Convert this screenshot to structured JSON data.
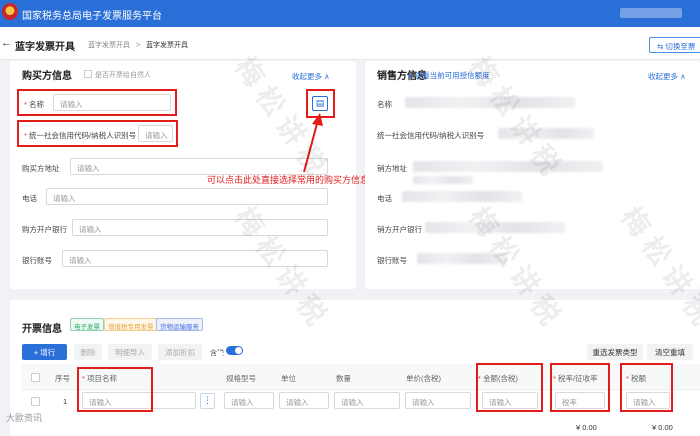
{
  "app": {
    "title": "国家税务总局电子发票服务平台",
    "switch_label": "切换至票"
  },
  "page": {
    "back_icon": "arrow-left-icon",
    "title": "蓝字发票开具",
    "breadcrumb": [
      "蓝字发票开具",
      "蓝字发票开具"
    ],
    "breadcrumb_sep": ">"
  },
  "buyer": {
    "title": "购买方信息",
    "natural_person": "是否开票给自然人",
    "collapse": "收起更多 ∧",
    "name_label": "名称",
    "name_placeholder": "请输入",
    "tax_id_label": "统一社会信用代码/纳税人识别号",
    "tax_id_placeholder": "请输入",
    "address_label": "购买方地址",
    "address_placeholder": "请输入",
    "phone_label": "电话",
    "phone_placeholder": "请输入",
    "bank_label": "购方开户银行",
    "bank_placeholder": "请输入",
    "account_label": "银行账号",
    "account_placeholder": "请输入",
    "required_mark": "*"
  },
  "annotation": {
    "text": "可以点击此处直接选择常用的购买方信息"
  },
  "seller": {
    "title": "销售方信息",
    "credit_link": "查看当前可用授信额度",
    "collapse": "收起更多 ∧",
    "name_label": "名称",
    "tax_id_label": "统一社会信用代码/纳税人识别号",
    "address_label": "销方地址",
    "phone_label": "电话",
    "bank_label": "销方开户银行",
    "account_label": "银行账号"
  },
  "invoice": {
    "title": "开票信息",
    "tags": [
      "电子发票",
      "增值税专用发票",
      "货物运输服务"
    ],
    "tag_colors": [
      "#2aa768",
      "#e8a93a",
      "#4a6ee0"
    ],
    "add_row": "+ 增行",
    "delete": "删除",
    "import": "明细导入",
    "discount": "添加折扣",
    "tax_included": "含税",
    "reselect_type": "重选发票类型",
    "clear": "清空重填",
    "headers": {
      "seq": "序号",
      "item_name": "项目名称",
      "spec": "规格型号",
      "unit": "单位",
      "qty": "数量",
      "unit_price": "单价(含税)",
      "amount": "金额(含税)",
      "tax_rate": "税率/征收率",
      "tax": "税额"
    },
    "rows": [
      {
        "seq": "1",
        "item_name_placeholder": "请输入",
        "spec_placeholder": "请输入",
        "unit_placeholder": "请输入",
        "qty_placeholder": "请输入",
        "unit_price_placeholder": "请输入",
        "amount_placeholder": "请输入",
        "tax_rate_placeholder": "税率",
        "tax_placeholder": "请输入"
      }
    ],
    "totals": {
      "amount": "¥ 0.00",
      "tax": "¥ 0.00"
    },
    "more_icon": "more-vertical-icon"
  },
  "watermark": {
    "text": "梅 松 讲 税"
  },
  "footer": {
    "logo_text": "大歐资讯"
  },
  "colors": {
    "brand": "#2a6fd8",
    "annotation_red": "#e21b1b"
  }
}
